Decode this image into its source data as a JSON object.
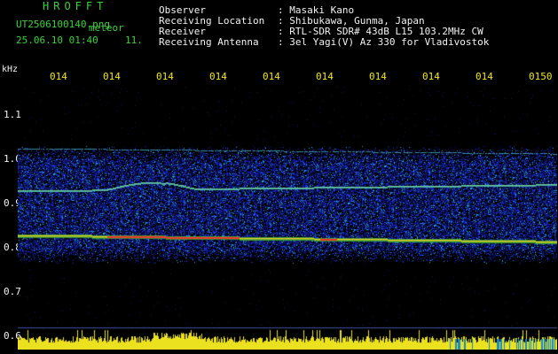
{
  "header": {
    "brand": "HROFFT",
    "filename": "UT2506100140.png",
    "tag": "meteor",
    "datetime": "25.06.10 01:40",
    "count": "11."
  },
  "info": [
    {
      "label": "Observer",
      "value": ": Masaki Kano"
    },
    {
      "label": "Receiving Location",
      "value": ": Shibukawa, Gunma, Japan"
    },
    {
      "label": "Receiver",
      "value": ": RTL-SDR SDR# 43dB L15 103.2MHz CW"
    },
    {
      "label": "Receiving Antenna",
      "value": ": 3el Yagi(V) Az 330 for Vladivostok"
    }
  ],
  "axis": {
    "unit": "kHz",
    "y_ticks": [
      "1.1",
      "1.0",
      "0.9",
      "0.8",
      "0.7",
      "0.6"
    ],
    "x_ticks": [
      "014",
      "014",
      "014",
      "014",
      "014",
      "014",
      "014",
      "014",
      "014",
      "0150"
    ]
  },
  "colors": {
    "background": "#000000",
    "header_green": "#3cd23c",
    "tick_yellow": "#f0e61e",
    "signal_red": "#ff2a2a",
    "noise_blue": "#1d3bd6"
  }
}
